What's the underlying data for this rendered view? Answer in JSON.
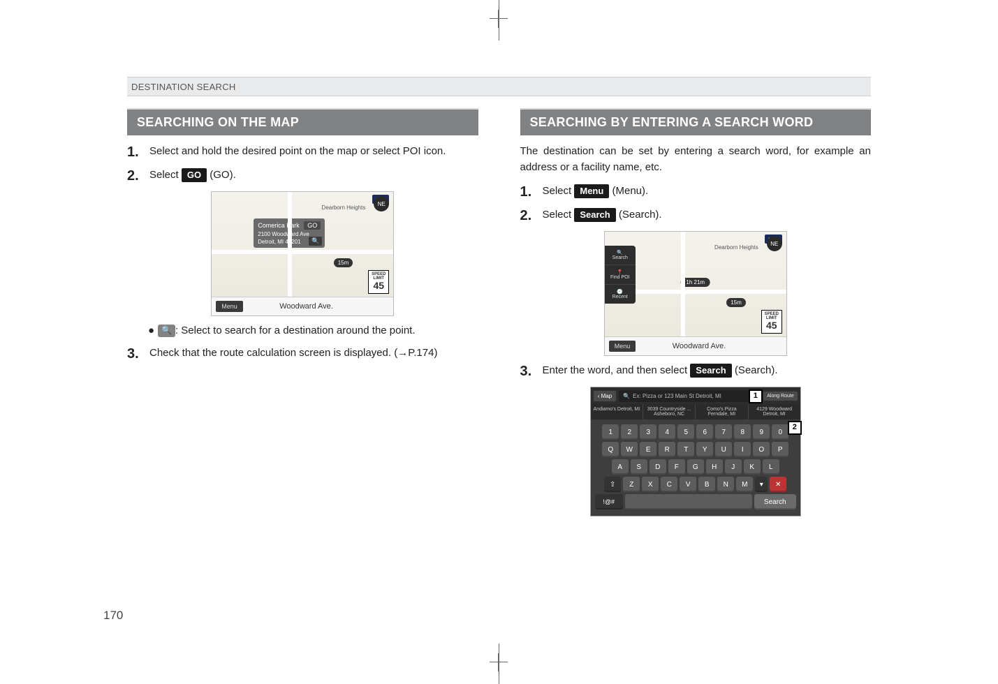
{
  "header": {
    "section": "DESTINATION SEARCH"
  },
  "page_number": "170",
  "left": {
    "title": "SEARCHING ON THE MAP",
    "step1": "Select and hold the desired point on the map or select POI icon.",
    "step2_pre": "Select ",
    "step2_btn": "GO",
    "step2_post": " (GO).",
    "bullet_pre": "",
    "bullet_text": ": Select to search for a destination around the point.",
    "step3": "Check that the route calculation screen is displayed. (→P.174)"
  },
  "right": {
    "title": "SEARCHING BY ENTERING A SEARCH WORD",
    "intro": "The destination can be set by entering a search word, for example an address or a facility name, etc.",
    "step1_pre": "Select ",
    "step1_btn": "Menu",
    "step1_post": " (Menu).",
    "step2_pre": "Select ",
    "step2_btn": "Search",
    "step2_post": " (Search).",
    "step3_pre": "Enter the word, and then select ",
    "step3_btn": "Search",
    "step3_post": " (Search)."
  },
  "shot1": {
    "poi_name": "Comerica Park",
    "poi_go": "GO",
    "poi_addr1": "2100 Woodward Ave",
    "poi_addr2": "Detroit, MI 48201",
    "sxm": "sxm",
    "compass": "NE",
    "scale": "15m",
    "speed_label": "SPEED LIMIT",
    "speed_value": "45",
    "menu": "Menu",
    "road": "Woodward Ave.",
    "region": "Dearborn Heights"
  },
  "shot2": {
    "sxm": "sxm",
    "compass": "NE",
    "dist": "1h 21m",
    "scale": "15m",
    "speed_label": "SPEED LIMIT",
    "speed_value": "45",
    "menu": "Menu",
    "road": "Woodward Ave.",
    "side": {
      "search": "Search",
      "findpoi": "Find POI",
      "recent": "Recent"
    },
    "region": "Dearborn Heights"
  },
  "kb": {
    "back": "Map",
    "placeholder": "Ex: Pizza or 123 Main St Detroit, MI",
    "along": "Along Route",
    "sugg": [
      "Andiamo's Detroit, MI",
      "3039 Countryside ... Asheboro, NC",
      "Como's Pizza Ferndale, MI",
      "4129 Woodward Detroit, MI"
    ],
    "row_num": [
      "1",
      "2",
      "3",
      "4",
      "5",
      "6",
      "7",
      "8",
      "9",
      "0"
    ],
    "row1": [
      "Q",
      "W",
      "E",
      "R",
      "T",
      "Y",
      "U",
      "I",
      "O",
      "P"
    ],
    "row2": [
      "A",
      "S",
      "D",
      "F",
      "G",
      "H",
      "J",
      "K",
      "L"
    ],
    "row3": [
      "Z",
      "X",
      "C",
      "V",
      "B",
      "N",
      "M"
    ],
    "shift": "⇧",
    "del": "✕",
    "sym": "!@#",
    "search": "Search",
    "callout1": "1",
    "callout2": "2"
  },
  "icons": {
    "magnify": "🔍"
  }
}
